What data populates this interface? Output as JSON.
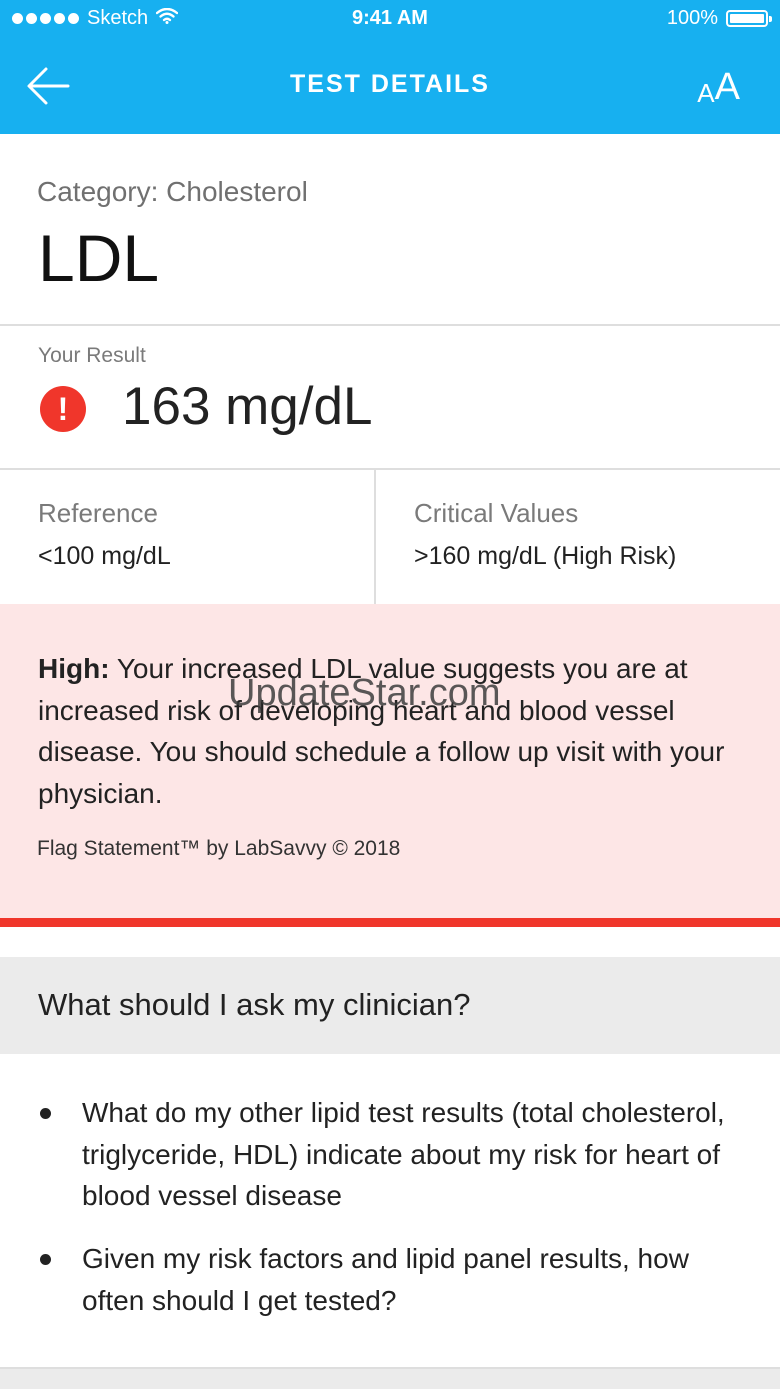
{
  "status_bar": {
    "carrier": "Sketch",
    "time": "9:41 AM",
    "battery": "100%"
  },
  "nav": {
    "title": "TEST DETAILS",
    "text_size_small": "A",
    "text_size_large": "A"
  },
  "test": {
    "category": "Category: Cholesterol",
    "name": "LDL"
  },
  "result": {
    "label": "Your Result",
    "value": "163 mg/dL",
    "icon": "!"
  },
  "reference": {
    "label": "Reference",
    "value": "<100 mg/dL"
  },
  "critical": {
    "label": "Critical Values",
    "value": ">160 mg/dL (High Risk)"
  },
  "flag": {
    "level": "High:",
    "message": "Your increased LDL value suggests you are at increased risk of developing heart and blood vessel disease. You should schedule a follow up visit with your physician.",
    "credit": "Flag Statement™ by LabSavvy © 2018"
  },
  "watermark": "UpdateStar.com",
  "clinician": {
    "title": "What should I ask my clinician?",
    "questions": [
      "What do my other lipid test results (total cholesterol, triglyceride, HDL) indicate about my risk for heart of blood vessel disease",
      "Given my risk factors and lipid panel results, how often should I get tested?"
    ]
  },
  "colors": {
    "header": "#17b0f0",
    "alert": "#f0362b",
    "flag_bg": "#fde6e6"
  }
}
